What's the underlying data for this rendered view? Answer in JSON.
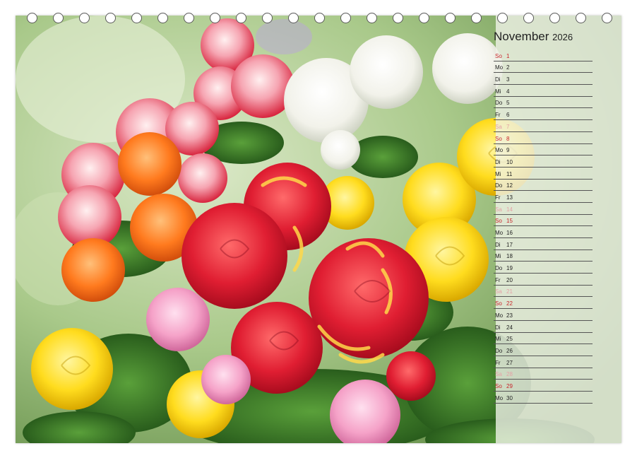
{
  "calendar": {
    "month": "November",
    "year": "2026",
    "days": [
      {
        "wd": "So",
        "d": "1",
        "type": "sun"
      },
      {
        "wd": "Mo",
        "d": "2",
        "type": "week"
      },
      {
        "wd": "Di",
        "d": "3",
        "type": "week"
      },
      {
        "wd": "Mi",
        "d": "4",
        "type": "week"
      },
      {
        "wd": "Do",
        "d": "5",
        "type": "week"
      },
      {
        "wd": "Fr",
        "d": "6",
        "type": "week"
      },
      {
        "wd": "Sa",
        "d": "7",
        "type": "sat"
      },
      {
        "wd": "So",
        "d": "8",
        "type": "sun"
      },
      {
        "wd": "Mo",
        "d": "9",
        "type": "week"
      },
      {
        "wd": "Di",
        "d": "10",
        "type": "week"
      },
      {
        "wd": "Mi",
        "d": "11",
        "type": "week"
      },
      {
        "wd": "Do",
        "d": "12",
        "type": "week"
      },
      {
        "wd": "Fr",
        "d": "13",
        "type": "week"
      },
      {
        "wd": "Sa",
        "d": "14",
        "type": "sat"
      },
      {
        "wd": "So",
        "d": "15",
        "type": "sun"
      },
      {
        "wd": "Mo",
        "d": "16",
        "type": "week"
      },
      {
        "wd": "Di",
        "d": "17",
        "type": "week"
      },
      {
        "wd": "Mi",
        "d": "18",
        "type": "week"
      },
      {
        "wd": "Do",
        "d": "19",
        "type": "week"
      },
      {
        "wd": "Fr",
        "d": "20",
        "type": "week"
      },
      {
        "wd": "Sa",
        "d": "21",
        "type": "sat"
      },
      {
        "wd": "So",
        "d": "22",
        "type": "sun"
      },
      {
        "wd": "Mo",
        "d": "23",
        "type": "week"
      },
      {
        "wd": "Di",
        "d": "24",
        "type": "week"
      },
      {
        "wd": "Mi",
        "d": "25",
        "type": "week"
      },
      {
        "wd": "Do",
        "d": "26",
        "type": "week"
      },
      {
        "wd": "Fr",
        "d": "27",
        "type": "week"
      },
      {
        "wd": "Sa",
        "d": "28",
        "type": "sat"
      },
      {
        "wd": "So",
        "d": "29",
        "type": "sun"
      },
      {
        "wd": "Mo",
        "d": "30",
        "type": "week"
      }
    ]
  },
  "colors": {
    "sunday": "#c8242a",
    "saturday": "#e5a1a6",
    "text": "#222222"
  },
  "photo": {
    "subject": "rose-bouquet",
    "rose_colors": [
      "#f03a46",
      "#ffe13a",
      "#ff8a2a",
      "#ffffff",
      "#f7a6c8",
      "#e8364f"
    ]
  }
}
